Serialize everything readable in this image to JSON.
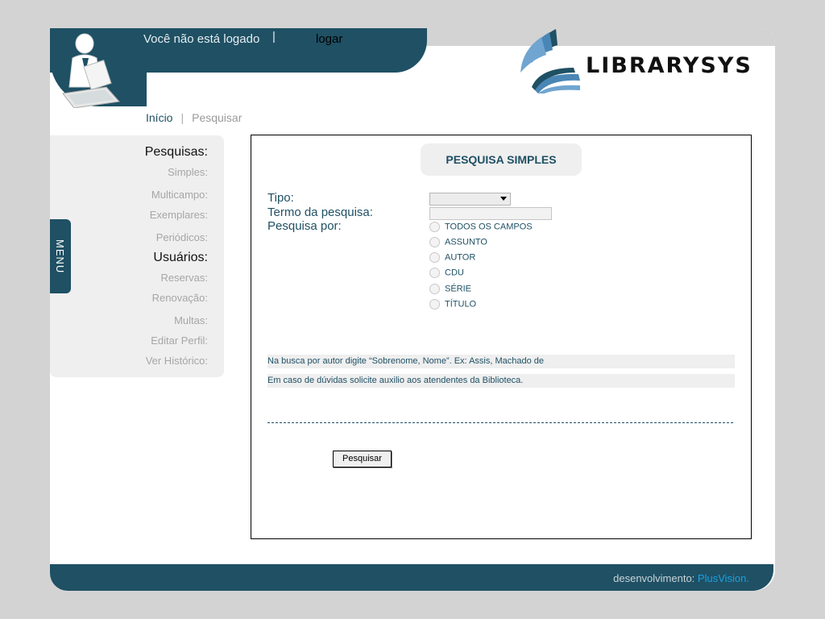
{
  "header": {
    "status": "Você não está logado",
    "separator": "|",
    "login_label": "logar"
  },
  "logo": {
    "text": "LIBRARYSYS"
  },
  "breadcrumb": {
    "home": "Início",
    "separator": "|",
    "current": "Pesquisar"
  },
  "sidebar": {
    "tab_label": "MENU",
    "searches_heading": "Pesquisas:",
    "search_items": [
      "Simples:",
      "Multicampo:",
      "Exemplares:",
      "Periódicos:"
    ],
    "users_heading": "Usuários:",
    "user_items": [
      "Reservas:",
      "Renovação:",
      "Multas:",
      "Editar Perfil:",
      "Ver Histórico:"
    ]
  },
  "main": {
    "title": "PESQUISA SIMPLES",
    "tipo_label": "Tipo:",
    "tipo_value": "",
    "termo_label": "Termo da pesquisa:",
    "termo_value": "",
    "por_label": "Pesquisa por:",
    "options": [
      "TODOS OS CAMPOS",
      "ASSUNTO",
      "AUTOR",
      "CDU",
      "SÉRIE",
      "TÍTULO"
    ],
    "hints": [
      "Na busca por autor digite “Sobrenome, Nome”. Ex: Assis, Machado de",
      "Em caso de dúvidas solicite auxilio aos atendentes da Biblioteca."
    ],
    "search_button": "Pesquisar"
  },
  "footer": {
    "credit": "desenvolvimento:",
    "brand": "PlusVision."
  },
  "colors": {
    "accent": "#1f5064",
    "background": "#d3d3d3",
    "brand_link": "#1aa0e0"
  }
}
